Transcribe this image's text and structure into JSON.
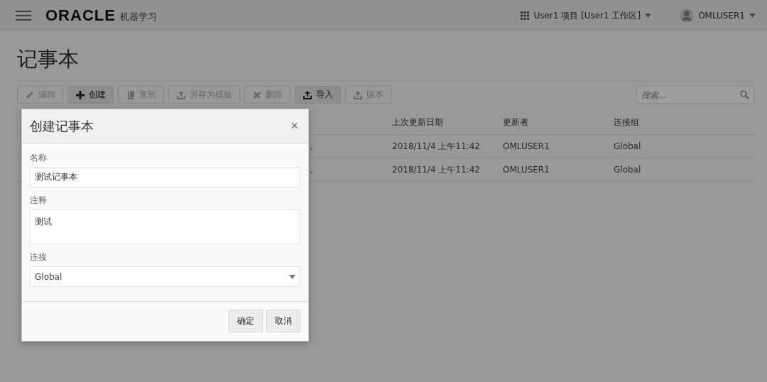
{
  "header": {
    "logo": "ORACLE",
    "product": "机器学习",
    "project": "User1 项目 [User1 工作区]",
    "user": "OMLUSER1"
  },
  "page_title": "记事本",
  "toolbar": [
    {
      "label": "编辑",
      "kind": "edit",
      "disabled": true
    },
    {
      "label": "创建",
      "kind": "create",
      "disabled": false
    },
    {
      "label": "复制",
      "kind": "copy",
      "disabled": true
    },
    {
      "label": "另存为模板",
      "kind": "export",
      "disabled": true
    },
    {
      "label": "删除",
      "kind": "delete",
      "disabled": true
    },
    {
      "label": "导入",
      "kind": "import",
      "disabled": false
    },
    {
      "label": "版本",
      "kind": "version",
      "disabled": true
    }
  ],
  "search": {
    "placeholder": "搜索..."
  },
  "table": {
    "columns": [
      "上次更新日期",
      "更新者",
      "连接组"
    ],
    "rows": [
      {
        "column_1": "。",
        "last_updated": "2018/11/4 上午11:42",
        "updated_by": "OMLUSER1",
        "connection_group": "Global"
      },
      {
        "column_1": "。",
        "last_updated": "2018/11/4 上午11:42",
        "updated_by": "OMLUSER1",
        "connection_group": "Global"
      }
    ]
  },
  "dialog": {
    "title": "创建记事本",
    "close": "×",
    "fields": [
      {
        "label": "名称",
        "kind": "text",
        "value": "测试记事本"
      },
      {
        "label": "注释",
        "kind": "textarea",
        "value": "测试"
      },
      {
        "label": "连接",
        "kind": "select",
        "value": "Global"
      }
    ],
    "buttons": [
      "确定",
      "取消"
    ]
  }
}
